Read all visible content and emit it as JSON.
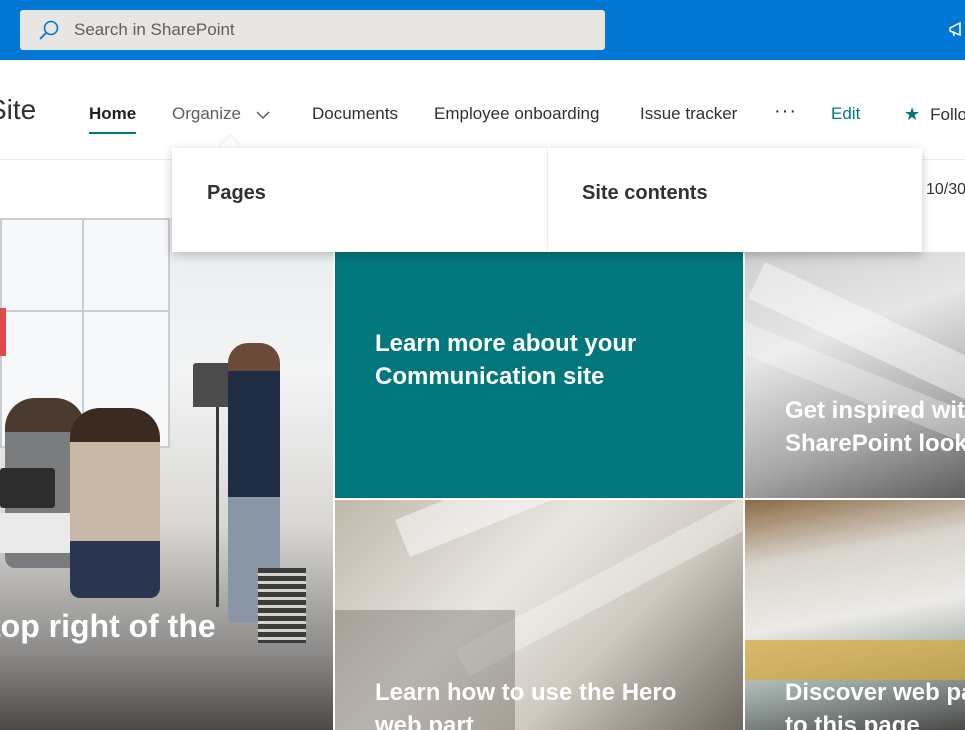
{
  "suite_bar": {
    "background": "#0078d4",
    "search": {
      "placeholder": "Search in SharePoint",
      "icon": "search-icon"
    },
    "right_icon": "megaphone-icon"
  },
  "site": {
    "title": "Site",
    "accent": "#03787c"
  },
  "nav": {
    "items": [
      {
        "label": "Home",
        "active": true
      },
      {
        "label": "Organize",
        "has_dropdown": true,
        "expanded": true
      },
      {
        "label": "Documents"
      },
      {
        "label": "Employee onboarding"
      },
      {
        "label": "Issue tracker"
      }
    ],
    "more_label": "···",
    "edit_label": "Edit",
    "follow_label": "Follo"
  },
  "dropdown": {
    "links": [
      "Pages",
      "Site contents"
    ]
  },
  "date_fragment": "10/30",
  "hero": {
    "tiles": [
      {
        "title": "top right of the"
      },
      {
        "title": "Learn more about your Communication site"
      },
      {
        "title": "Get inspired wit SharePoint look"
      },
      {
        "title": "Learn how to use the Hero web part"
      },
      {
        "title": "Discover web pa add to this page"
      }
    ]
  }
}
